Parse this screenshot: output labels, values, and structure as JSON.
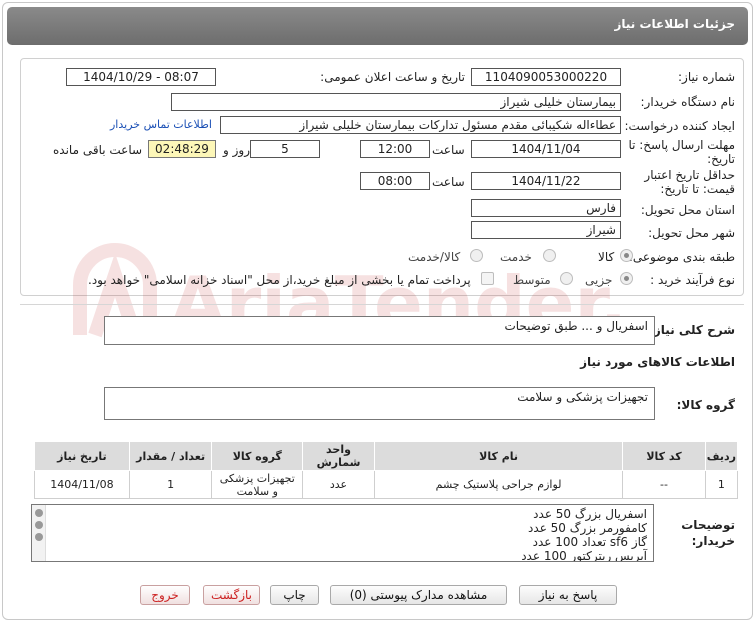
{
  "header": {
    "title": "جزئیات اطلاعات نیاز"
  },
  "fields": {
    "need_number_label": "شماره نیاز:",
    "need_number": "1104090053000220",
    "announce_label": "تاریخ و ساعت اعلان عمومی:",
    "announce_value": "1404/10/29 - 08:07",
    "buyer_org_label": "نام دستگاه خریدار:",
    "buyer_org": "بیمارستان خلیلی شیراز",
    "creator_label": "ایجاد کننده درخواست:",
    "creator": "عطاءاله شکیبائی مقدم مسئول تدارکات  بیمارستان خلیلی شیراز",
    "contact_link": "اطلاعات تماس خریدار",
    "deadline_label": "مهلت ارسال پاسخ: تا تاریخ:",
    "deadline_date": "1404/11/04",
    "hour_label": "ساعت",
    "deadline_time": "12:00",
    "days_value": "5",
    "days_label": "روز و",
    "remaining_timer": "02:48:29",
    "remaining_label": "ساعت باقی مانده",
    "validity_label": "حداقل تاریخ اعتبار قیمت: تا تاریخ:",
    "validity_date": "1404/11/22",
    "validity_time": "08:00",
    "province_label": "استان محل تحویل:",
    "province": "فارس",
    "city_label": "شهر محل تحویل:",
    "city": "شیراز",
    "category_label": "طبقه بندی موضوعی:",
    "category_options": [
      "کالا",
      "خدمت",
      "کالا/خدمت"
    ],
    "category_selected": "کالا",
    "process_label": "نوع فرآیند خرید :",
    "process_options": [
      "جزیی",
      "متوسط"
    ],
    "process_note": "پرداخت تمام یا بخشی از مبلغ خرید،از محل \"اسناد خزانه اسلامی\" خواهد بود."
  },
  "summary": {
    "label": "شرح کلی نیاز:",
    "value": "اسفریال و ... طبق توضیحات"
  },
  "goods_section": {
    "title": "اطلاعات کالاهای مورد نیاز",
    "group_label": "گروه کالا:",
    "group_value": "تجهیزات پزشکی و سلامت"
  },
  "table": {
    "headers": [
      "ردیف",
      "کد کالا",
      "نام کالا",
      "واحد شمارش",
      "گروه کالا",
      "تعداد / مقدار",
      "تاریخ نیاز"
    ],
    "rows": [
      [
        "1",
        "--",
        "لوازم جراحی پلاستیک چشم",
        "عدد",
        "تجهیزات پزشکی و سلامت",
        "1",
        "1404/11/08"
      ]
    ]
  },
  "notes": {
    "label": "توضیحات خریدار:",
    "lines": [
      "اسفریال بزرگ 50 عدد",
      "کامفورمر بزرگ 50 عدد",
      "گاز sf6 تعداد 100 عدد",
      "آیریس ریترکتور 100 عدد"
    ]
  },
  "buttons": {
    "reply": "پاسخ به نیاز",
    "attachments": "مشاهده مدارک پیوستی (0)",
    "print": "چاپ",
    "back": "بازگشت",
    "exit": "خروج"
  },
  "watermark": {
    "text": "AriaTender.neT"
  }
}
